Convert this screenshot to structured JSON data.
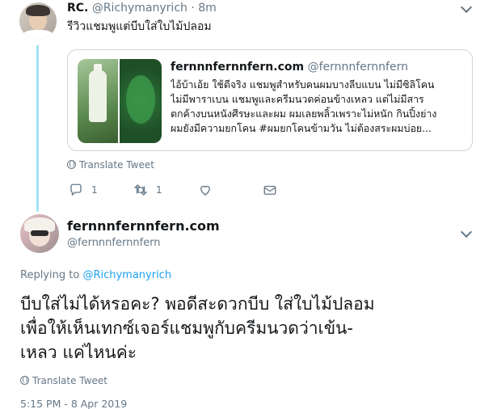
{
  "tweet1": {
    "display_name": "RC.",
    "handle": "@Richymanyrich",
    "separator": "·",
    "time": "8m",
    "text": "รีวิวแชมพูแต่บีบใส่ใบไม้ปลอม",
    "quoted": {
      "display_name": "fernnnfernnfern.com",
      "handle": "@fernnnfernnfern",
      "lines": [
        "ไอ้บ้าเอ้ย ใช้ดีจริง แชมพูสำหรับคนผมบางลีบแบน ไม่มีซิลิโคน",
        "ไม่มีพาราเบน แชมพูและครีมนวดค่อนข้างเหลว แต่ไม่มีสาร",
        "ตกค้างบนหนังศีรษะและผม ผมเลยพลิ้วเพราะไม่หนัก กินปิ้งย่าง",
        "ผมยังมีความยกโคน #ผมยกโคนข้ามวัน ไม่ต้องสระผมบ่อย..."
      ]
    },
    "translate_label": "Translate Tweet",
    "actions": {
      "reply_count": "1",
      "retweet_count": "1",
      "like_count": "",
      "dm_count": ""
    }
  },
  "tweet2": {
    "display_name": "fernnnfernnfern.com",
    "handle": "@fernnnfernnfern",
    "replying_prefix": "Replying to",
    "replying_to": "@Richymanyrich",
    "lines": [
      "บีบใส่ไม่ได้หรอคะ? พอดีสะดวกบีบ ใส่ใบไม้ปลอม",
      "เพื่อให้เห็นเทกซ์เจอร์แชมพูกับครีมนวดว่าเข้น-",
      "เหลว แค่ไหนค่ะ"
    ],
    "translate_label": "Translate Tweet",
    "timestamp": "5:15 PM - 8 Apr 2019"
  },
  "colors": {
    "thread_line": "#a4e2f6",
    "link": "#1da1f2",
    "muted": "#657786",
    "text": "#14171a",
    "border": "#ccd6dd"
  },
  "icons": [
    "reply-icon",
    "retweet-icon",
    "heart-icon",
    "envelope-icon",
    "globe-icon",
    "chevron-down-icon"
  ]
}
